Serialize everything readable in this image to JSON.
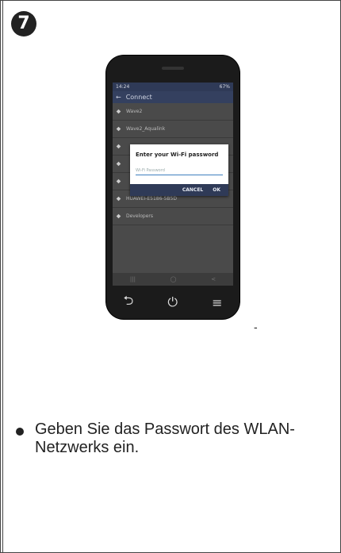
{
  "step_number": "7",
  "trailing_mark": "-",
  "instruction": "Geben Sie das Passwort des WLAN-Netzwerks ein.",
  "phone": {
    "status_left": "14:24",
    "status_right": "67%",
    "appbar": {
      "back": "←",
      "title": "Connect"
    },
    "networks": [
      "Wave2",
      "Wave2_Aqualink",
      "",
      "",
      "",
      "HUAWEI-E5186-5B5D",
      "Developers"
    ],
    "dialog": {
      "title": "Enter your Wi-Fi password",
      "placeholder": "Wi-Fi Password",
      "cancel": "CANCEL",
      "ok": "OK"
    },
    "softnav": [
      "|||",
      "◯",
      "<"
    ],
    "hwnav": [
      "⮌",
      "⏻",
      "≡"
    ]
  }
}
